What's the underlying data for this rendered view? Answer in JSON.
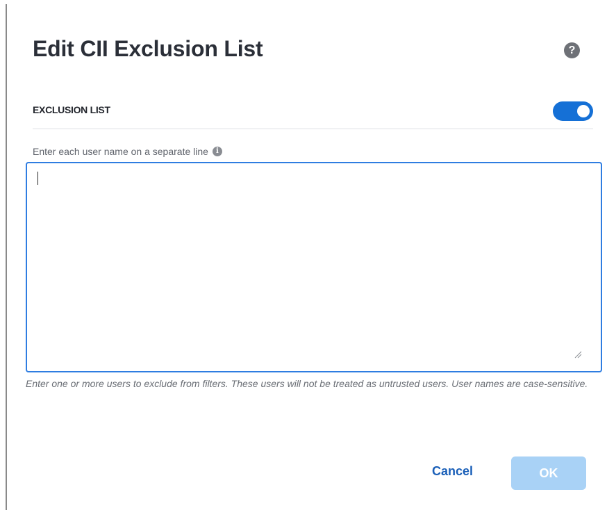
{
  "dialog": {
    "title": "Edit CII Exclusion List",
    "help_icon": "help-icon",
    "help_symbol": "?"
  },
  "exclusion_list": {
    "section_label": "EXCLUSION LIST",
    "toggle_enabled": true,
    "toggle_color": "#1570d6"
  },
  "usernames_field": {
    "label": "Enter each user name on a separate line",
    "info_icon": "info-icon",
    "info_symbol": "i",
    "value": "",
    "placeholder": "",
    "border_color": "#2f7de1"
  },
  "help_text": "Enter one or more users to exclude from filters. These users will not be treated as untrusted users. User names are case-sensitive.",
  "footer": {
    "cancel_label": "Cancel",
    "ok_label": "OK",
    "ok_enabled": false,
    "ok_color": "#a9d2f6",
    "cancel_color": "#1a5fb8"
  }
}
